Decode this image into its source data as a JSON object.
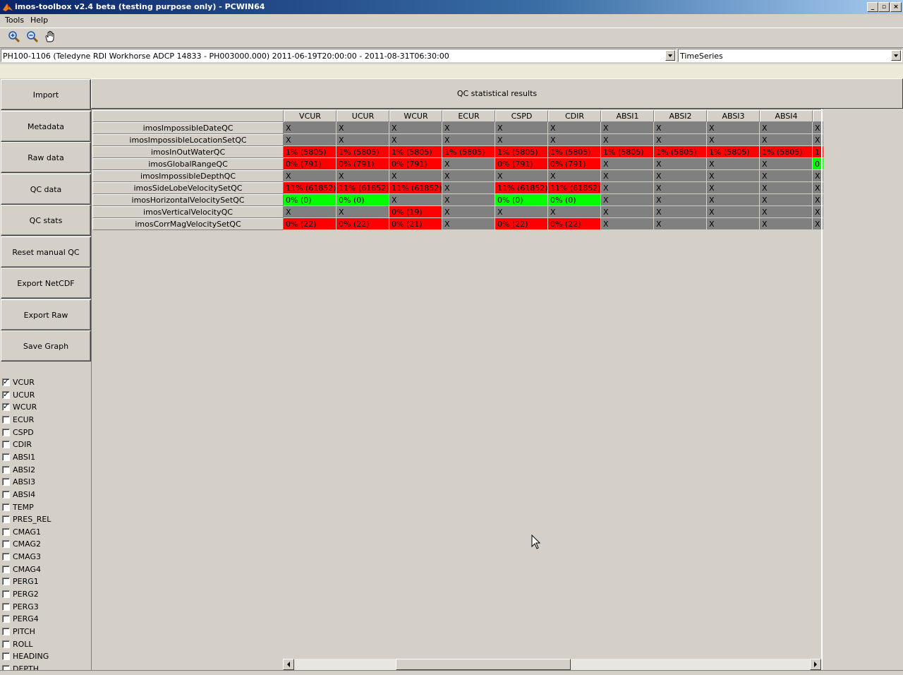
{
  "window": {
    "title": "imos-toolbox v2.4 beta (testing purpose only) - PCWIN64",
    "controls": [
      "_",
      "▫",
      "×"
    ]
  },
  "menu": [
    {
      "label": "Tools"
    },
    {
      "label": "Help"
    }
  ],
  "toolbar": {
    "zoom_in_icon": "zoom-in-icon",
    "zoom_out_icon": "zoom-out-icon",
    "pan_icon": "pan-hand-icon"
  },
  "dataset_select": {
    "value": "PH100-1106 (Teledyne RDI Workhorse ADCP 14833 - PH003000.000) 2011-06-19T20:00:00 - 2011-08-31T06:30:00"
  },
  "mode_select": {
    "value": "TimeSeries"
  },
  "left_buttons": [
    {
      "label": "Import"
    },
    {
      "label": "Metadata"
    },
    {
      "label": "Raw data"
    },
    {
      "label": "QC data"
    },
    {
      "label": "QC stats"
    },
    {
      "label": "Reset manual QC"
    },
    {
      "label": "Export NetCDF"
    },
    {
      "label": "Export Raw"
    },
    {
      "label": "Save Graph"
    }
  ],
  "panel_title": "QC statistical results",
  "table": {
    "columns": [
      "VCUR",
      "UCUR",
      "WCUR",
      "ECUR",
      "CSPD",
      "CDIR",
      "ABSI1",
      "ABSI2",
      "ABSI3",
      "ABSI4",
      ""
    ],
    "rows": [
      {
        "name": "imosImpossibleDateQC",
        "cells": [
          [
            "X",
            "na"
          ],
          [
            "X",
            "na"
          ],
          [
            "X",
            "na"
          ],
          [
            "X",
            "na"
          ],
          [
            "X",
            "na"
          ],
          [
            "X",
            "na"
          ],
          [
            "X",
            "na"
          ],
          [
            "X",
            "na"
          ],
          [
            "X",
            "na"
          ],
          [
            "X",
            "na"
          ],
          [
            "X",
            "na"
          ]
        ]
      },
      {
        "name": "imosImpossibleLocationSetQC",
        "cells": [
          [
            "X",
            "na"
          ],
          [
            "X",
            "na"
          ],
          [
            "X",
            "na"
          ],
          [
            "X",
            "na"
          ],
          [
            "X",
            "na"
          ],
          [
            "X",
            "na"
          ],
          [
            "X",
            "na"
          ],
          [
            "X",
            "na"
          ],
          [
            "X",
            "na"
          ],
          [
            "X",
            "na"
          ],
          [
            "X",
            "na"
          ]
        ]
      },
      {
        "name": "imosInOutWaterQC",
        "cells": [
          [
            "1% (5805)",
            "red"
          ],
          [
            "1% (5805)",
            "red"
          ],
          [
            "1% (5805)",
            "red"
          ],
          [
            "1% (5805)",
            "red"
          ],
          [
            "1% (5805)",
            "red"
          ],
          [
            "1% (5805)",
            "red"
          ],
          [
            "1% (5805)",
            "red"
          ],
          [
            "1% (5805)",
            "red"
          ],
          [
            "1% (5805)",
            "red"
          ],
          [
            "1% (5805)",
            "red"
          ],
          [
            "1",
            "red"
          ]
        ]
      },
      {
        "name": "imosGlobalRangeQC",
        "cells": [
          [
            "0% (791)",
            "red"
          ],
          [
            "0% (791)",
            "red"
          ],
          [
            "0% (791)",
            "red"
          ],
          [
            "X",
            "na"
          ],
          [
            "0% (791)",
            "red"
          ],
          [
            "0% (791)",
            "red"
          ],
          [
            "X",
            "na"
          ],
          [
            "X",
            "na"
          ],
          [
            "X",
            "na"
          ],
          [
            "X",
            "na"
          ],
          [
            "0",
            "green"
          ]
        ]
      },
      {
        "name": "imosImpossibleDepthQC",
        "cells": [
          [
            "X",
            "na"
          ],
          [
            "X",
            "na"
          ],
          [
            "X",
            "na"
          ],
          [
            "X",
            "na"
          ],
          [
            "X",
            "na"
          ],
          [
            "X",
            "na"
          ],
          [
            "X",
            "na"
          ],
          [
            "X",
            "na"
          ],
          [
            "X",
            "na"
          ],
          [
            "X",
            "na"
          ],
          [
            "X",
            "na"
          ]
        ]
      },
      {
        "name": "imosSideLobeVelocitySetQC",
        "cells": [
          [
            "11% (61852)",
            "red"
          ],
          [
            "11% (61852)",
            "red"
          ],
          [
            "11% (61852)",
            "red"
          ],
          [
            "X",
            "na"
          ],
          [
            "11% (61852)",
            "red"
          ],
          [
            "11% (61852)",
            "red"
          ],
          [
            "X",
            "na"
          ],
          [
            "X",
            "na"
          ],
          [
            "X",
            "na"
          ],
          [
            "X",
            "na"
          ],
          [
            "X",
            "na"
          ]
        ]
      },
      {
        "name": "imosHorizontalVelocitySetQC",
        "cells": [
          [
            "0% (0)",
            "green"
          ],
          [
            "0% (0)",
            "green"
          ],
          [
            "X",
            "na"
          ],
          [
            "X",
            "na"
          ],
          [
            "0% (0)",
            "green"
          ],
          [
            "0% (0)",
            "green"
          ],
          [
            "X",
            "na"
          ],
          [
            "X",
            "na"
          ],
          [
            "X",
            "na"
          ],
          [
            "X",
            "na"
          ],
          [
            "X",
            "na"
          ]
        ]
      },
      {
        "name": "imosVerticalVelocityQC",
        "cells": [
          [
            "X",
            "na"
          ],
          [
            "X",
            "na"
          ],
          [
            "0% (19)",
            "red"
          ],
          [
            "X",
            "na"
          ],
          [
            "X",
            "na"
          ],
          [
            "X",
            "na"
          ],
          [
            "X",
            "na"
          ],
          [
            "X",
            "na"
          ],
          [
            "X",
            "na"
          ],
          [
            "X",
            "na"
          ],
          [
            "X",
            "na"
          ]
        ]
      },
      {
        "name": "imosCorrMagVelocitySetQC",
        "cells": [
          [
            "0% (22)",
            "red"
          ],
          [
            "0% (22)",
            "red"
          ],
          [
            "0% (21)",
            "red"
          ],
          [
            "X",
            "na"
          ],
          [
            "0% (22)",
            "red"
          ],
          [
            "0% (22)",
            "red"
          ],
          [
            "X",
            "na"
          ],
          [
            "X",
            "na"
          ],
          [
            "X",
            "na"
          ],
          [
            "X",
            "na"
          ],
          [
            "X",
            "na"
          ]
        ]
      }
    ]
  },
  "variables": [
    {
      "label": "VCUR",
      "checked": true
    },
    {
      "label": "UCUR",
      "checked": true
    },
    {
      "label": "WCUR",
      "checked": true
    },
    {
      "label": "ECUR",
      "checked": false
    },
    {
      "label": "CSPD",
      "checked": false
    },
    {
      "label": "CDIR",
      "checked": false
    },
    {
      "label": "ABSI1",
      "checked": false
    },
    {
      "label": "ABSI2",
      "checked": false
    },
    {
      "label": "ABSI3",
      "checked": false
    },
    {
      "label": "ABSI4",
      "checked": false
    },
    {
      "label": "TEMP",
      "checked": false
    },
    {
      "label": "PRES_REL",
      "checked": false
    },
    {
      "label": "CMAG1",
      "checked": false
    },
    {
      "label": "CMAG2",
      "checked": false
    },
    {
      "label": "CMAG3",
      "checked": false
    },
    {
      "label": "CMAG4",
      "checked": false
    },
    {
      "label": "PERG1",
      "checked": false
    },
    {
      "label": "PERG2",
      "checked": false
    },
    {
      "label": "PERG3",
      "checked": false
    },
    {
      "label": "PERG4",
      "checked": false
    },
    {
      "label": "PITCH",
      "checked": false
    },
    {
      "label": "ROLL",
      "checked": false
    },
    {
      "label": "HEADING",
      "checked": false
    },
    {
      "label": "DEPTH",
      "checked": false
    }
  ],
  "colors": {
    "flag_red": "#ff0000",
    "flag_green": "#00ff00",
    "not_applicable": "#808080",
    "titlebar_start": "#0a246a"
  }
}
